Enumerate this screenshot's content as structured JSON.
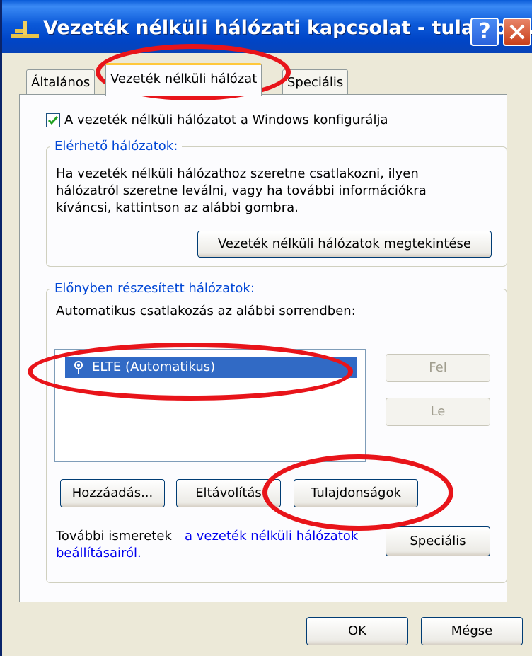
{
  "window": {
    "title": "Vezeték nélküli hálózati kapcsolat - tulajdon...",
    "help_label": "?"
  },
  "tabs": [
    {
      "label": "Általános"
    },
    {
      "label": "Vezeték nélküli hálózat",
      "active": true
    },
    {
      "label": "Speciális"
    }
  ],
  "checkbox": {
    "label": "A vezeték nélküli hálózatot a Windows konfigurálja",
    "checked": true
  },
  "available_networks": {
    "legend": "Elérhető hálózatok:",
    "description_lines": [
      "Ha vezeték nélküli hálózathoz szeretne csatlakozni, ilyen",
      "hálózatról szeretne leválni, vagy ha további információkra",
      "kíváncsi, kattintson az alábbi gombra."
    ],
    "view_button": "Vezeték nélküli hálózatok megtekintése"
  },
  "preferred_networks": {
    "legend": "Előnyben részesített hálózatok:",
    "description": "Automatikus csatlakozás az alábbi sorrendben:",
    "list_items": [
      "ELTE (Automatikus)"
    ],
    "up_button": "Fel",
    "down_button": "Le",
    "add_button": "Hozzáadás...",
    "remove_button": "Eltávolítás",
    "properties_button": "Tulajdonságok"
  },
  "footer": {
    "more_info_text": "További ismeretek",
    "link_line1": "a vezeték nélküli hálózatok",
    "link_line2": "beállításairól.",
    "advanced_button": "Speciális"
  },
  "dialog_buttons": {
    "ok": "OK",
    "cancel": "Mégse"
  },
  "colors": {
    "annotation": "#e8141a",
    "selection": "#316ac5",
    "titlebar": "#0045c7"
  }
}
